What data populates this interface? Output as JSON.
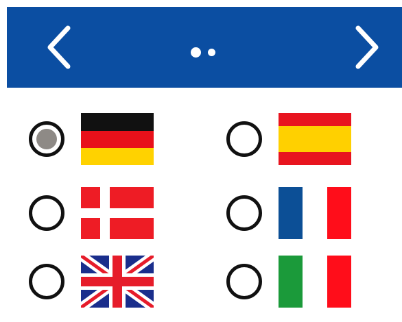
{
  "header": {
    "background": "#0b4ea2",
    "prev_icon": "chevron-left-icon",
    "next_icon": "chevron-right-icon",
    "page_dots": 2
  },
  "languages": [
    {
      "flag": "germany-flag-icon",
      "selected": true
    },
    {
      "flag": "spain-flag-icon",
      "selected": false
    },
    {
      "flag": "denmark-flag-icon",
      "selected": false
    },
    {
      "flag": "france-flag-icon",
      "selected": false
    },
    {
      "flag": "united-kingdom-flag-icon",
      "selected": false
    },
    {
      "flag": "italy-flag-icon",
      "selected": false
    }
  ]
}
